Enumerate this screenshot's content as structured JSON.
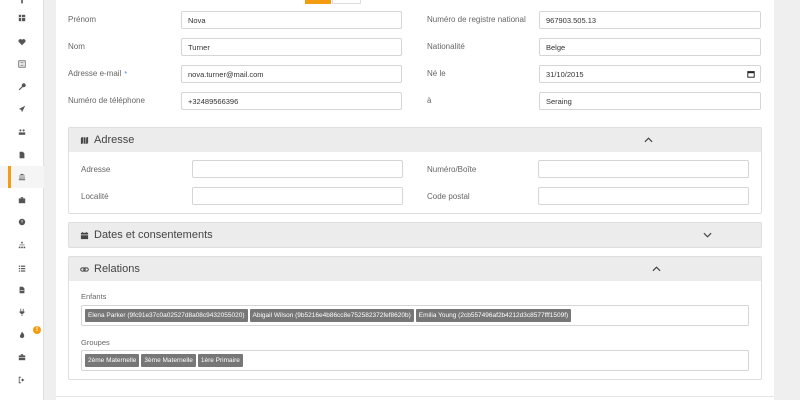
{
  "sidebar": {
    "icons": [
      "grid-icon",
      "heart-icon",
      "list-alt-icon",
      "wrench-icon",
      "paper-plane-icon",
      "users-icon",
      "file-icon",
      "bank-icon",
      "briefcase-icon",
      "clock-icon",
      "sitemap-icon",
      "list-icon",
      "document-icon",
      "plug-icon",
      "fire-icon",
      "suitcase-icon",
      "sign-out-icon"
    ],
    "active_index": 7,
    "badge": "!"
  },
  "form": {
    "prenom_label": "Prénom",
    "prenom_value": "Nova",
    "nom_label": "Nom",
    "nom_value": "Turner",
    "email_label": "Adresse e-mail",
    "email_required": "*",
    "email_value": "nova.turner@mail.com",
    "phone_label": "Numéro de téléphone",
    "phone_value": "+32489566396",
    "registre_label": "Numéro de registre national",
    "registre_value": "967903.505.13",
    "nationalite_label": "Nationalité",
    "nationalite_value": "Belge",
    "ne_le_label": "Né le",
    "ne_le_value": "31/10/2015",
    "a_label": "à",
    "a_value": "Seraing"
  },
  "adresse": {
    "title": "Adresse",
    "adresse_label": "Adresse",
    "adresse_value": "",
    "numero_label": "Numéro/Boîte",
    "numero_value": "",
    "localite_label": "Localité",
    "localite_value": "",
    "code_postal_label": "Code postal",
    "code_postal_value": ""
  },
  "dates": {
    "title": "Dates et consentements"
  },
  "relations": {
    "title": "Relations",
    "enfants_label": "Enfants",
    "enfants": [
      "Elena Parker (9fc91e37c0a02527d8a08c9432055020)",
      "Abigail Wilson (9b5216e4b86cc8e752582372fef8620b)",
      "Emilia Young (2cb557496af2b4212d3c8577fff1509f)"
    ],
    "groupes_label": "Groupes",
    "groupes": [
      "2ème Maternelle",
      "3ème Maternelle",
      "1ère Primaire"
    ]
  },
  "colors": {
    "accent": "#f39c12",
    "tag": "#777777",
    "required": "#2d8ce0"
  }
}
